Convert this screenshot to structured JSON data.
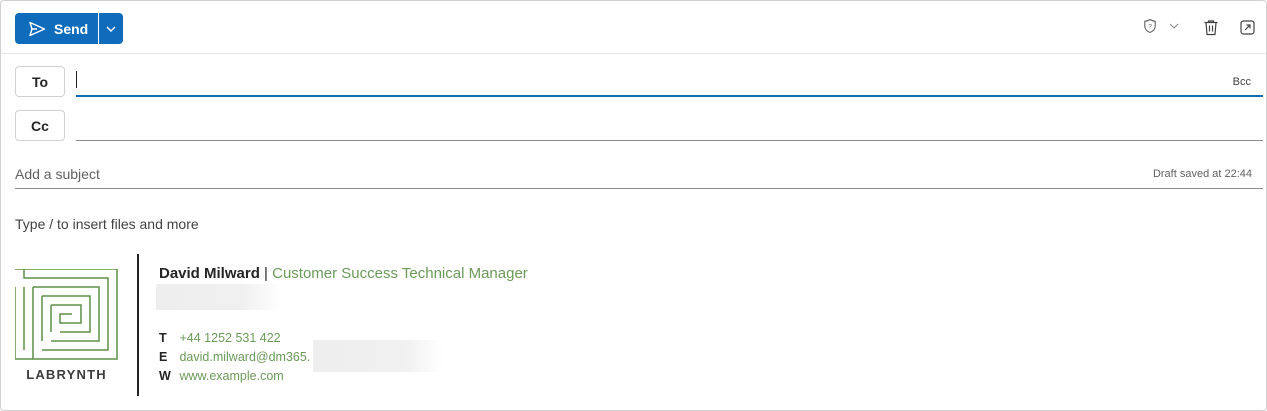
{
  "toolbar": {
    "send_label": "Send",
    "icons": [
      "send-icon",
      "chevron-down-icon",
      "sensitivity-shield-icon",
      "chevron-down-icon",
      "trash-icon",
      "pop-out-icon"
    ]
  },
  "recipients": {
    "to_label": "To",
    "cc_label": "Cc",
    "to_value": "",
    "cc_value": "",
    "bcc_label": "Bcc"
  },
  "subject": {
    "placeholder": "Add a subject",
    "draft_status": "Draft saved at 22:44"
  },
  "body": {
    "hint": "Type / to insert files and more"
  },
  "signature": {
    "logo_text": "LABRYNTH",
    "name": "David Milward",
    "separator": "|",
    "title": "Customer Success Technical Manager",
    "phone_key": "T",
    "phone": "+44 1252 531 422",
    "email_key": "E",
    "email": "david.milward@dm365.",
    "web_key": "W",
    "web": "www.example.com"
  },
  "colors": {
    "accent": "#0f6cbd",
    "signature_green": "#6a9a58",
    "logo_green": "#5d9147"
  }
}
